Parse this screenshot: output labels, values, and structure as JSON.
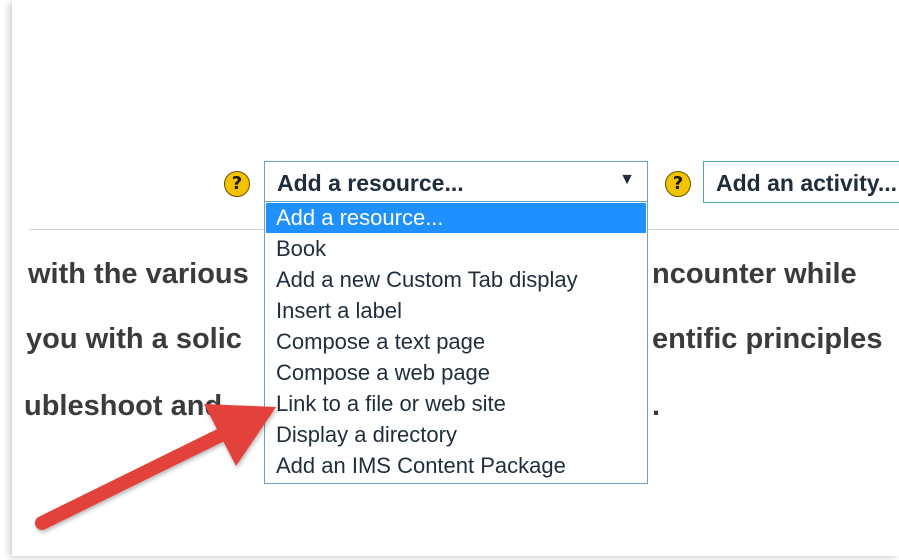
{
  "toolbar": {
    "resource_select": {
      "selected": "Add a resource...",
      "options": [
        "Add a resource...",
        "Book",
        "Add a new Custom Tab display",
        "Insert a label",
        "Compose a text page",
        "Compose a web page",
        "Link to a file or web site",
        "Display a directory",
        "Add an IMS Content Package"
      ]
    },
    "activity_select": {
      "selected": "Add an activity..."
    },
    "help_symbol": "?"
  },
  "content": {
    "line1_left": "with the various",
    "line1_right": "ncounter while",
    "line2_left": "you with a solic",
    "line2_right": "entific principles",
    "line3_left": "ubleshoot and",
    "line3_right": "."
  },
  "colors": {
    "highlight": "#1e90ff",
    "help_icon": "#f3c300",
    "annotation_arrow": "#e2433a"
  }
}
